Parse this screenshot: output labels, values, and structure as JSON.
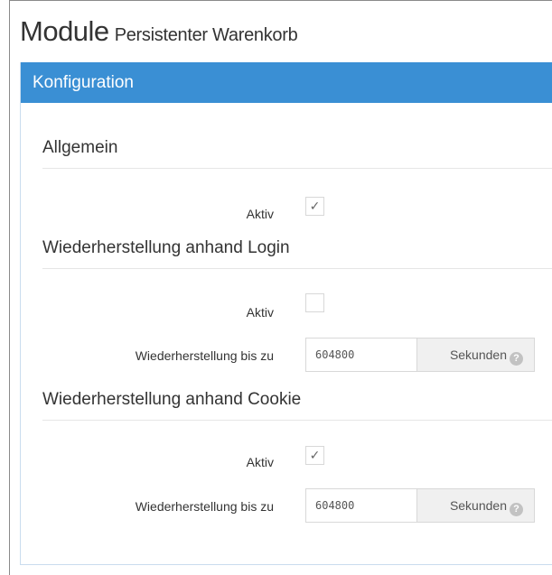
{
  "page": {
    "title": "Module",
    "subtitle": "Persistenter Warenkorb"
  },
  "panel": {
    "heading": "Konfiguration"
  },
  "sections": [
    {
      "title": "Allgemein",
      "fields": {
        "active_label": "Aktiv",
        "active_checked": true,
        "check_glyph": "✓"
      }
    },
    {
      "title": "Wiederherstellung anhand Login",
      "fields": {
        "active_label": "Aktiv",
        "active_checked": false,
        "check_glyph": "",
        "restore_label": "Wiederherstellung bis zu",
        "restore_value": "604800",
        "unit_label": "Sekunden",
        "help_glyph": "?"
      }
    },
    {
      "title": "Wiederherstellung anhand Cookie",
      "fields": {
        "active_label": "Aktiv",
        "active_checked": true,
        "check_glyph": "✓",
        "restore_label": "Wiederherstellung bis zu",
        "restore_value": "604800",
        "unit_label": "Sekunden",
        "help_glyph": "?"
      }
    }
  ],
  "colors": {
    "header_bg": "#3a8fd4",
    "header_text": "#ffffff",
    "addon_bg": "#f0f0f0"
  }
}
